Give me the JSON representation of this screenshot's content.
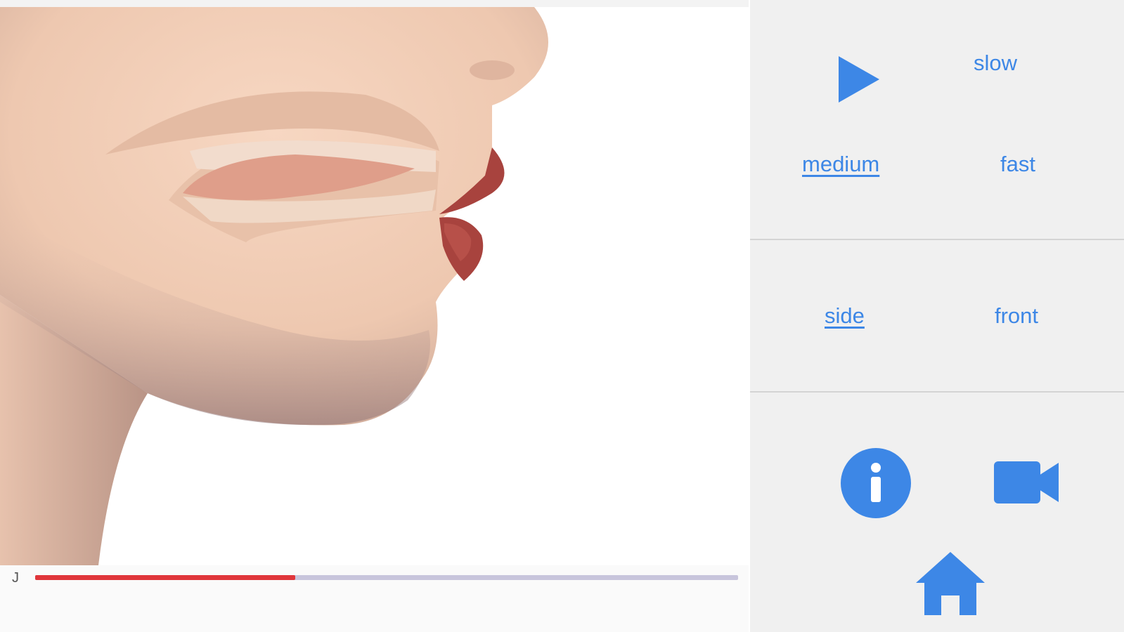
{
  "player": {
    "phoneme": "J",
    "progress": 0.37
  },
  "controls": {
    "play_icon": "play-icon",
    "speed_options": [
      {
        "label": "slow",
        "active": false
      },
      {
        "label": "medium",
        "active": true
      },
      {
        "label": "fast",
        "active": false
      }
    ],
    "view_options": [
      {
        "label": "side",
        "active": true
      },
      {
        "label": "front",
        "active": false
      }
    ],
    "bottom_icons": [
      "info-icon",
      "video-camera-icon",
      "home-icon"
    ]
  },
  "colors": {
    "accent": "#3d87e6",
    "progress": "#e0363b",
    "track": "#c8c5dc",
    "panel_bg": "#f0f0f0",
    "skin": "#f3cfb6",
    "lip": "#a8433e"
  }
}
